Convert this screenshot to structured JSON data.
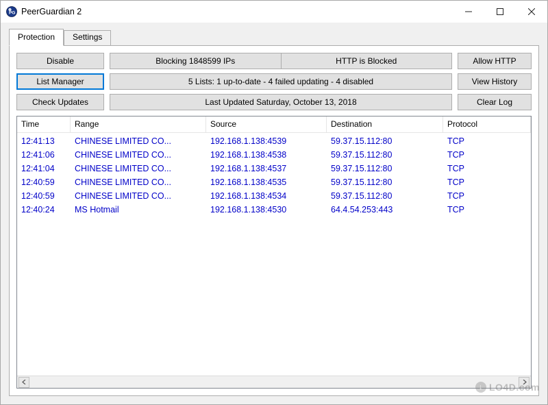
{
  "window": {
    "title": "PeerGuardian 2"
  },
  "tabs": {
    "protection": "Protection",
    "settings": "Settings"
  },
  "buttons": {
    "disable": "Disable",
    "list_manager": "List Manager",
    "check_updates": "Check Updates",
    "allow_http": "Allow HTTP",
    "view_history": "View History",
    "clear_log": "Clear Log"
  },
  "status": {
    "blocking": "Blocking 1848599 IPs",
    "http": "HTTP is Blocked",
    "lists": "5 Lists: 1 up-to-date - 4 failed updating - 4 disabled",
    "last_updated": "Last Updated Saturday, October 13, 2018"
  },
  "columns": {
    "time": "Time",
    "range": "Range",
    "source": "Source",
    "destination": "Destination",
    "protocol": "Protocol"
  },
  "log": [
    {
      "time": "12:41:13",
      "range": "CHINESE LIMITED CO...",
      "source": "192.168.1.138:4539",
      "dest": "59.37.15.112:80",
      "proto": "TCP"
    },
    {
      "time": "12:41:06",
      "range": "CHINESE LIMITED CO...",
      "source": "192.168.1.138:4538",
      "dest": "59.37.15.112:80",
      "proto": "TCP"
    },
    {
      "time": "12:41:04",
      "range": "CHINESE LIMITED CO...",
      "source": "192.168.1.138:4537",
      "dest": "59.37.15.112:80",
      "proto": "TCP"
    },
    {
      "time": "12:40:59",
      "range": "CHINESE LIMITED CO...",
      "source": "192.168.1.138:4535",
      "dest": "59.37.15.112:80",
      "proto": "TCP"
    },
    {
      "time": "12:40:59",
      "range": "CHINESE LIMITED CO...",
      "source": "192.168.1.138:4534",
      "dest": "59.37.15.112:80",
      "proto": "TCP"
    },
    {
      "time": "12:40:24",
      "range": "MS Hotmail",
      "source": "192.168.1.138:4530",
      "dest": "64.4.54.253:443",
      "proto": "TCP"
    }
  ],
  "watermark": "LO4D.com"
}
